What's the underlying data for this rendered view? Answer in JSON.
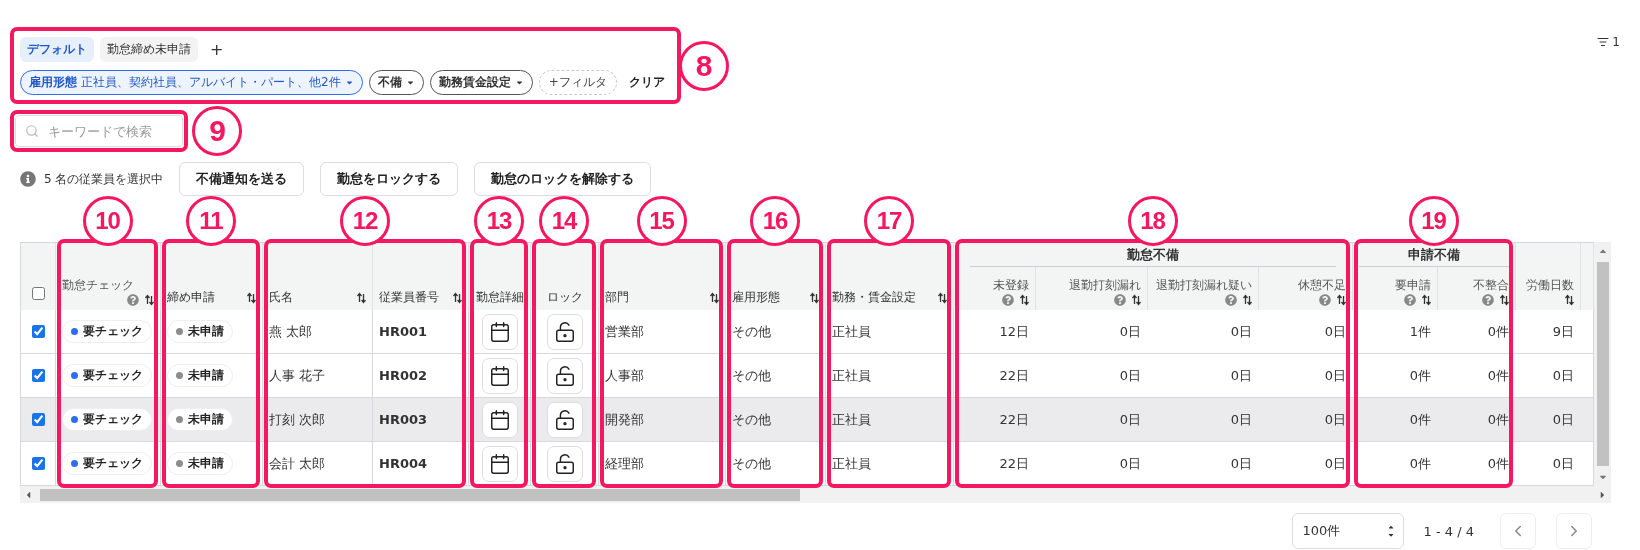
{
  "filter_panel": {
    "annotation": "8",
    "views": [
      {
        "label": "デフォルト",
        "selected": true
      },
      {
        "label": "勤怠締め未申請",
        "selected": false
      }
    ],
    "add_view": "+",
    "chips": [
      {
        "label": "雇用形態",
        "value": "正社員、契約社員、アルバイト・パート、他2件",
        "active": true
      },
      {
        "label": "不備",
        "active": false
      },
      {
        "label": "勤務賃金設定",
        "active": false
      }
    ],
    "add_filter": "+フィルタ",
    "clear": "クリア"
  },
  "filter_count": "1",
  "search": {
    "placeholder": "キーワードで検索",
    "annotation": "9"
  },
  "selection": "5 名の従業員を選択中",
  "actions": [
    "不備通知を送る",
    "勤怠をロックする",
    "勤怠のロックを解除する"
  ],
  "table": {
    "select_all": {
      "checked": false
    },
    "columns": [
      {
        "kind": "status",
        "label": "勤怠チェック",
        "help": true,
        "sortable": true,
        "annotation": "10"
      },
      {
        "kind": "status",
        "label": "締め申請",
        "help": false,
        "sortable": true,
        "annotation": "11"
      },
      {
        "kind": "text",
        "label": "氏名",
        "help": false,
        "sortable": true,
        "annotation": "12"
      },
      {
        "kind": "code",
        "label": "従業員番号",
        "help": false,
        "sortable": true,
        "annotation_continues": true
      },
      {
        "kind": "calendar",
        "label": "勤怠詳細",
        "help": false,
        "sortable": false,
        "annotation": "13"
      },
      {
        "kind": "lock",
        "label": "ロック",
        "help": false,
        "sortable": false,
        "annotation": "14"
      },
      {
        "kind": "text",
        "label": "部門",
        "help": false,
        "sortable": true,
        "annotation": "15"
      },
      {
        "kind": "text",
        "label": "雇用形態",
        "help": false,
        "sortable": true,
        "annotation": "16"
      },
      {
        "kind": "text",
        "label": "勤務・賃金設定",
        "help": false,
        "sortable": true,
        "annotation": "17"
      },
      {
        "kind": "number",
        "label": "未登録",
        "help": true,
        "sortable": true,
        "group": {
          "label": "勤怠不備",
          "annotation": "18"
        }
      },
      {
        "kind": "number",
        "label": "退勤打刻漏れ",
        "help": true,
        "sortable": true,
        "in_group": true
      },
      {
        "kind": "number",
        "label": "退勤打刻漏れ疑い",
        "help": true,
        "sortable": true,
        "in_group": true
      },
      {
        "kind": "number",
        "label": "休憩不足",
        "help": true,
        "sortable": true,
        "in_group": true
      },
      {
        "kind": "number",
        "label": "要申請",
        "help": true,
        "sortable": true,
        "group": {
          "label": "申請不備",
          "annotation": "19"
        }
      },
      {
        "kind": "number",
        "label": "不整合",
        "help": true,
        "sortable": true,
        "in_group": true
      },
      {
        "kind": "number",
        "label": "労働日数",
        "help": false,
        "sortable": true
      }
    ],
    "rows": [
      {
        "selected": true,
        "hovered": false,
        "cells": [
          {
            "label": "要チェック",
            "color": "#2f6cf0"
          },
          {
            "label": "未申請",
            "color": "#8c8c8c"
          },
          "燕 太郎",
          "HR001",
          "",
          {
            "locked": false
          },
          "営業部",
          "その他",
          "正社員",
          "12日",
          "0日",
          "0日",
          "0日",
          "1件",
          "0件",
          "9日"
        ]
      },
      {
        "selected": true,
        "hovered": false,
        "cells": [
          {
            "label": "要チェック",
            "color": "#2f6cf0"
          },
          {
            "label": "未申請",
            "color": "#8c8c8c"
          },
          "人事 花子",
          "HR002",
          "",
          {
            "locked": false
          },
          "人事部",
          "その他",
          "正社員",
          "22日",
          "0日",
          "0日",
          "0日",
          "0件",
          "0件",
          "0日"
        ]
      },
      {
        "selected": true,
        "hovered": true,
        "cells": [
          {
            "label": "要チェック",
            "color": "#2f6cf0"
          },
          {
            "label": "未申請",
            "color": "#8c8c8c"
          },
          "打刻 次郎",
          "HR003",
          "",
          {
            "locked": false
          },
          "開発部",
          "その他",
          "正社員",
          "22日",
          "0日",
          "0日",
          "0日",
          "0件",
          "0件",
          "0日"
        ]
      },
      {
        "selected": true,
        "hovered": false,
        "cells": [
          {
            "label": "要チェック",
            "color": "#2f6cf0"
          },
          {
            "label": "未申請",
            "color": "#8c8c8c"
          },
          "会計 太郎",
          "HR004",
          "",
          {
            "locked": false
          },
          "経理部",
          "その他",
          "正社員",
          "22日",
          "0日",
          "0日",
          "0日",
          "0件",
          "0件",
          "0日"
        ]
      }
    ]
  },
  "pagination": {
    "page_size": "100件",
    "range": "1 - 4 / 4"
  }
}
